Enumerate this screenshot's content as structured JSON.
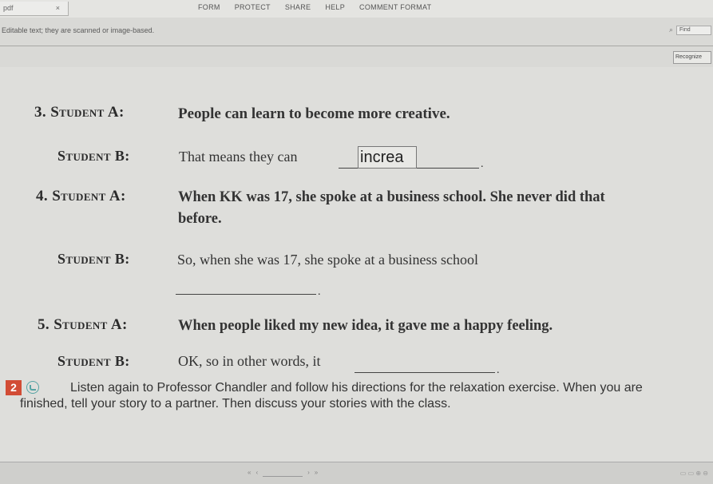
{
  "window": {
    "file_tab": "pdf",
    "menu": [
      "FORM",
      "PROTECT",
      "SHARE",
      "HELP",
      "COMMENT FORMAT"
    ],
    "notice": "Editable text; they are scanned or image-based.",
    "notice_button": "Find",
    "recognize_button": "Recognize"
  },
  "exercise": {
    "items": [
      {
        "number_label": "3. Student A:",
        "a_text": "People can learn to become more creative.",
        "b_label": "Student B:",
        "b_text": "That means they can",
        "answer": "increa"
      },
      {
        "number_label": "4. Student A:",
        "a_text_line1": "When KK was 17, she spoke at a business school. She never did that",
        "a_text_line2": "before.",
        "b_label": "Student B:",
        "b_text": "So, when she was 17, she spoke at a business school"
      },
      {
        "number_label": "5. Student A:",
        "a_text": "When people liked my new idea, it gave me a happy feeling.",
        "b_label": "Student B:",
        "b_text": "OK, so in other words, it"
      }
    ],
    "task_number": "2",
    "instructions": "Listen again to Professor Chandler and follow his directions for the relaxation exercise. When you are finished, tell your story to a partner. Then discuss your stories with the class."
  }
}
